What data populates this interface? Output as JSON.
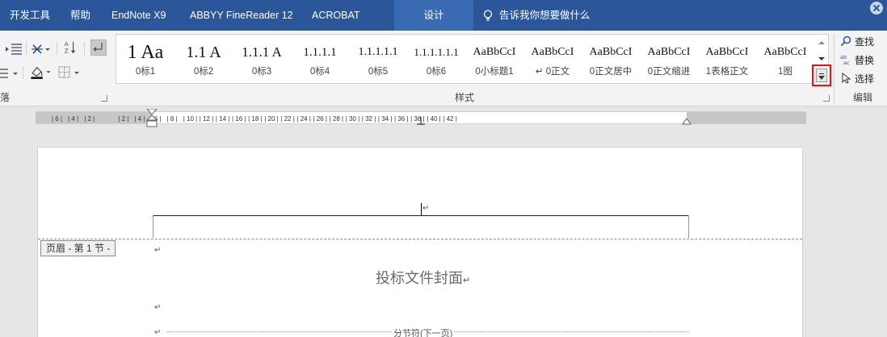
{
  "tabs": [
    {
      "label": "开发工具",
      "active": false
    },
    {
      "label": "帮助",
      "active": false
    },
    {
      "label": "EndNote X9",
      "active": false
    },
    {
      "label": "ABBYY FineReader 12",
      "active": false
    },
    {
      "label": "ACROBAT",
      "active": false
    },
    {
      "label": "设计",
      "active": true
    }
  ],
  "tell_me": {
    "label": "告诉我你想要做什么",
    "icon": "lightbulb-icon"
  },
  "ribbon": {
    "paragraph_group_label": "落",
    "styles": [
      {
        "sample": "1 Aa",
        "name": "0标1",
        "size": 24
      },
      {
        "sample": "1.1 A",
        "name": "0标2",
        "size": 20
      },
      {
        "sample": "1.1.1 A",
        "name": "0标3",
        "size": 17
      },
      {
        "sample": "1.1.1.1",
        "name": "0标4",
        "size": 15
      },
      {
        "sample": "1.1.1.1.1",
        "name": "0标5",
        "size": 14
      },
      {
        "sample": "1.1.1.1.1.1",
        "name": "0标6",
        "size": 13
      },
      {
        "sample": "AaBbCcI",
        "name": "0小标题1",
        "size": 14
      },
      {
        "sample": "AaBbCcI",
        "name": "↵ 0正文",
        "size": 14
      },
      {
        "sample": "AaBbCcI",
        "name": "0正文居中",
        "size": 14
      },
      {
        "sample": "AaBbCcI",
        "name": "0正文缩进",
        "size": 14
      },
      {
        "sample": "AaBbCcI",
        "name": "1表格正文",
        "size": 14
      },
      {
        "sample": "AaBbCcI",
        "name": "1图",
        "size": 14
      }
    ],
    "styles_group_label": "样式",
    "edit": {
      "find": "查找",
      "replace": "替换",
      "select": "选择",
      "group_label": "编辑"
    }
  },
  "ruler": {
    "labels": [
      "6",
      "4",
      "2",
      "2",
      "4",
      "6",
      "8",
      "10",
      "12",
      "14",
      "16",
      "18",
      "20",
      "22",
      "24",
      "26",
      "28",
      "30",
      "32",
      "34",
      "36",
      "38",
      "40",
      "42"
    ]
  },
  "document": {
    "header_tag": "页眉 - 第 1 节 -",
    "cover_title": "投标文件封面",
    "para_mark": "↵",
    "section_break": "分节符(下一页)"
  },
  "colors": {
    "tabbar": "#2b579a",
    "active_tab": "#3a6ab1",
    "highlight_border": "#e0141e"
  }
}
